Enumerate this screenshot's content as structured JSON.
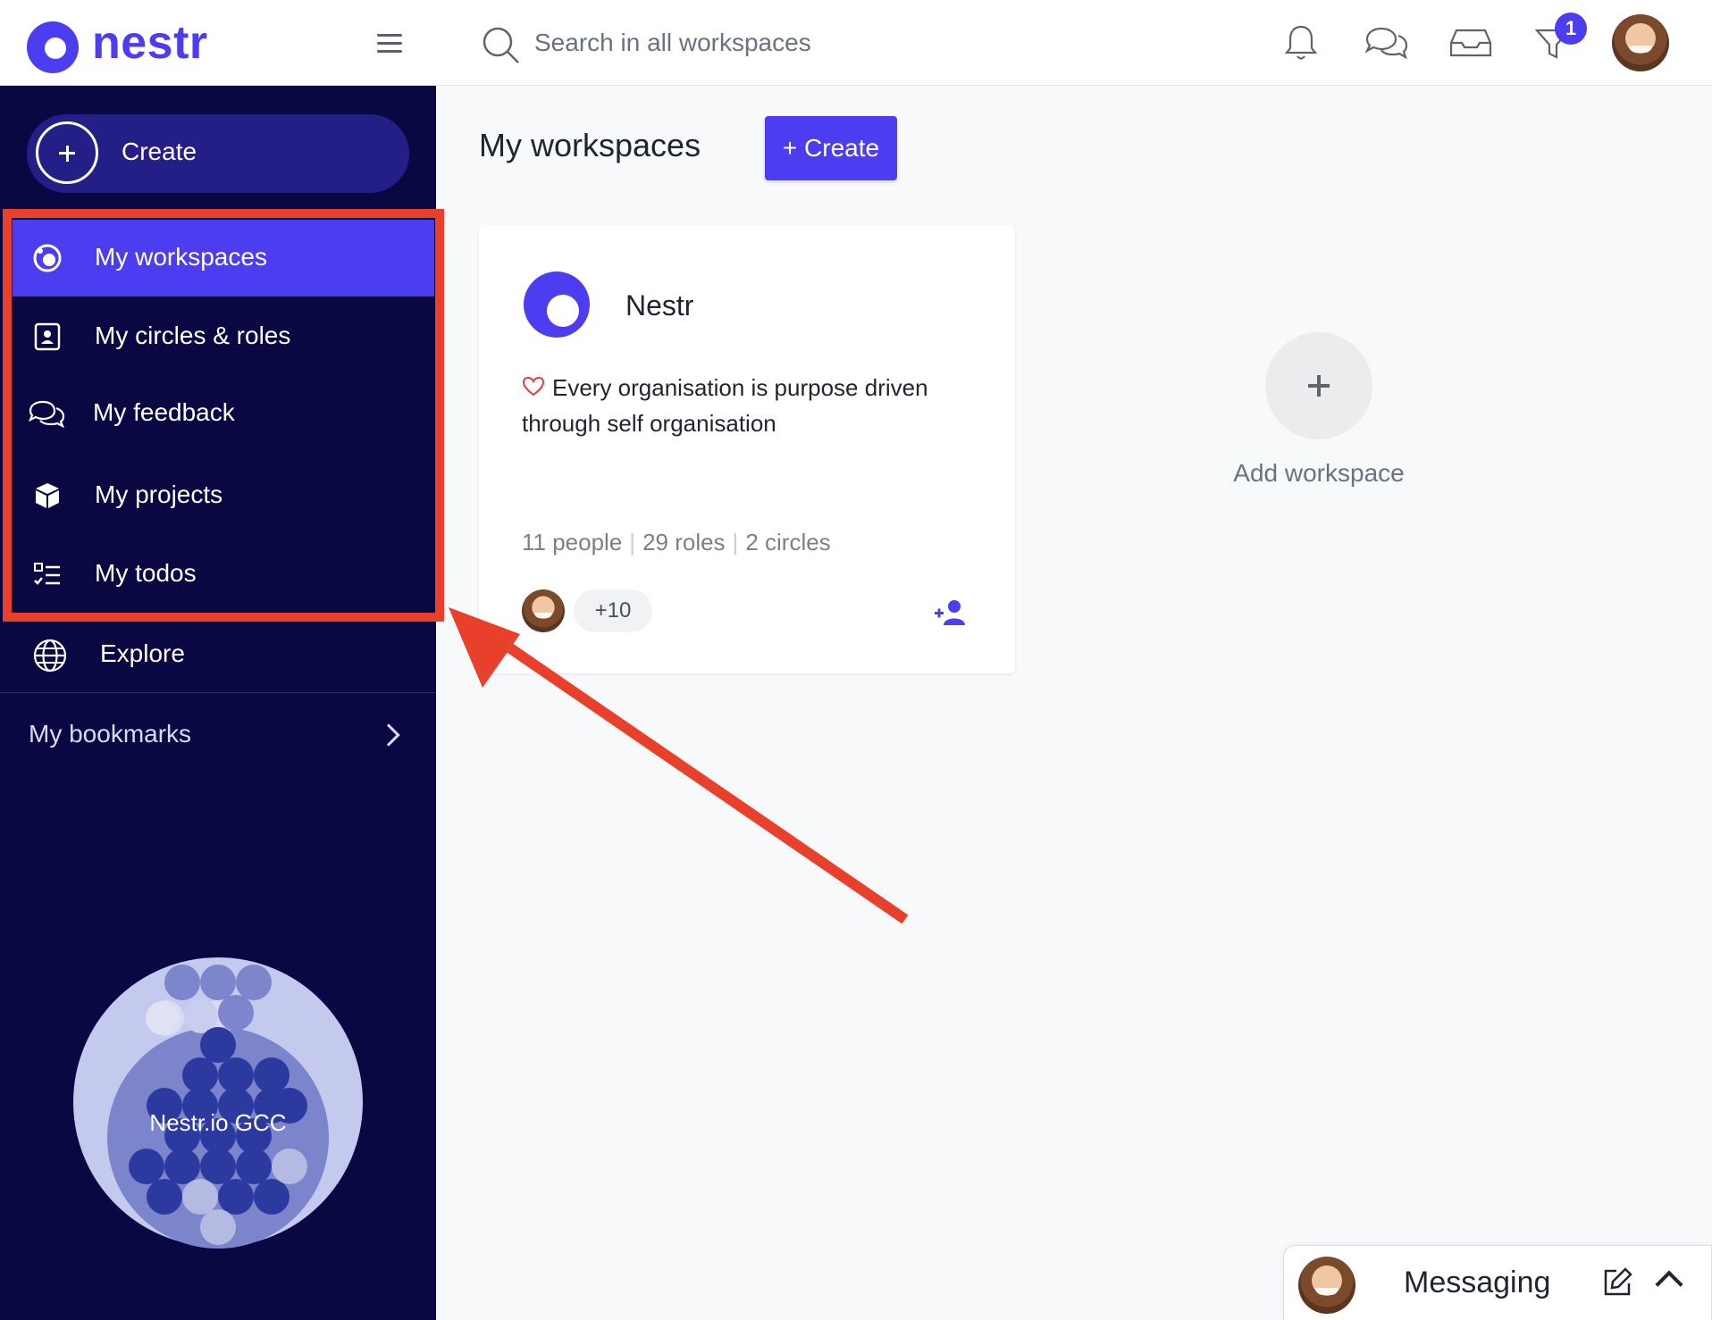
{
  "app": {
    "logo_text": "nestr"
  },
  "header": {
    "search_placeholder": "Search in all workspaces",
    "notification_badge": "1"
  },
  "sidebar": {
    "create_label": "Create",
    "items": [
      {
        "label": "My workspaces",
        "icon": "workspace-icon",
        "active": true
      },
      {
        "label": "My circles & roles",
        "icon": "contact-card-icon",
        "active": false
      },
      {
        "label": "My feedback",
        "icon": "chat-bubbles-icon",
        "active": false
      },
      {
        "label": "My projects",
        "icon": "cube-icon",
        "active": false
      },
      {
        "label": "My todos",
        "icon": "checklist-icon",
        "active": false
      }
    ],
    "explore_label": "Explore",
    "bookmarks_label": "My bookmarks",
    "circle_viz_label": "Nestr.io GCC"
  },
  "main": {
    "title": "My workspaces",
    "create_button": "+ Create",
    "workspace": {
      "name": "Nestr",
      "purpose": "Every organisation is purpose driven through self organisation",
      "people": "11 people",
      "roles": "29 roles",
      "circles": "2 circles",
      "more_members": "+10"
    },
    "add_workspace_label": "Add workspace"
  },
  "messaging": {
    "label": "Messaging"
  },
  "colors": {
    "brand": "#4c3df0",
    "sidebar_bg": "#0a0843",
    "annotation": "#e8402b"
  }
}
